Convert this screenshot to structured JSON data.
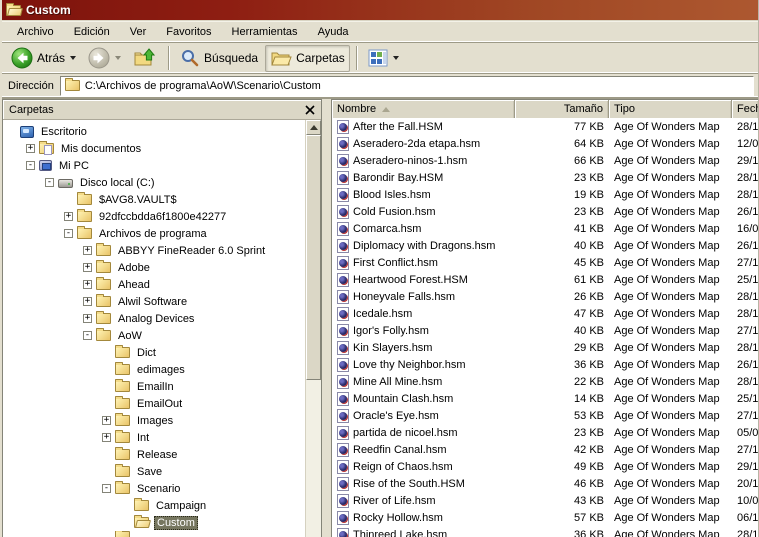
{
  "window": {
    "title": "Custom"
  },
  "menu": {
    "items": [
      {
        "label": "Archivo"
      },
      {
        "label": "Edición"
      },
      {
        "label": "Ver"
      },
      {
        "label": "Favoritos"
      },
      {
        "label": "Herramientas"
      },
      {
        "label": "Ayuda"
      }
    ]
  },
  "toolbar": {
    "back_label": "Atrás",
    "search_label": "Búsqueda",
    "folders_label": "Carpetas"
  },
  "address": {
    "label": "Dirección",
    "path": "C:\\Archivos de programa\\AoW\\Scenario\\Custom"
  },
  "folders_panel": {
    "title": "Carpetas"
  },
  "tree": {
    "items": [
      {
        "label": "Escritorio",
        "level": 0,
        "toggle": "",
        "icon": "desktop"
      },
      {
        "label": "Mis documentos",
        "level": 1,
        "toggle": "+",
        "icon": "folder-docs"
      },
      {
        "label": "Mi PC",
        "level": 1,
        "toggle": "-",
        "icon": "computer"
      },
      {
        "label": "Disco local (C:)",
        "level": 2,
        "toggle": "-",
        "icon": "drive"
      },
      {
        "label": "$AVG8.VAULT$",
        "level": 3,
        "toggle": "",
        "icon": "folder"
      },
      {
        "label": "92dfccbdda6f1800e42277",
        "level": 3,
        "toggle": "+",
        "icon": "folder"
      },
      {
        "label": "Archivos de programa",
        "level": 3,
        "toggle": "-",
        "icon": "folder"
      },
      {
        "label": "ABBYY FineReader 6.0 Sprint",
        "level": 4,
        "toggle": "+",
        "icon": "folder"
      },
      {
        "label": "Adobe",
        "level": 4,
        "toggle": "+",
        "icon": "folder"
      },
      {
        "label": "Ahead",
        "level": 4,
        "toggle": "+",
        "icon": "folder"
      },
      {
        "label": "Alwil Software",
        "level": 4,
        "toggle": "+",
        "icon": "folder"
      },
      {
        "label": "Analog Devices",
        "level": 4,
        "toggle": "+",
        "icon": "folder"
      },
      {
        "label": "AoW",
        "level": 4,
        "toggle": "-",
        "icon": "folder"
      },
      {
        "label": "Dict",
        "level": 5,
        "toggle": "",
        "icon": "folder"
      },
      {
        "label": "edimages",
        "level": 5,
        "toggle": "",
        "icon": "folder"
      },
      {
        "label": "EmailIn",
        "level": 5,
        "toggle": "",
        "icon": "folder"
      },
      {
        "label": "EmailOut",
        "level": 5,
        "toggle": "",
        "icon": "folder"
      },
      {
        "label": "Images",
        "level": 5,
        "toggle": "+",
        "icon": "folder"
      },
      {
        "label": "Int",
        "level": 5,
        "toggle": "+",
        "icon": "folder"
      },
      {
        "label": "Release",
        "level": 5,
        "toggle": "",
        "icon": "folder"
      },
      {
        "label": "Save",
        "level": 5,
        "toggle": "",
        "icon": "folder"
      },
      {
        "label": "Scenario",
        "level": 5,
        "toggle": "-",
        "icon": "folder"
      },
      {
        "label": "Campaign",
        "level": 6,
        "toggle": "",
        "icon": "folder"
      },
      {
        "label": "Custom",
        "level": 6,
        "toggle": "",
        "icon": "folder-open",
        "selected": true
      },
      {
        "label": "",
        "level": 5,
        "toggle": "",
        "icon": "folder",
        "partial": true
      }
    ]
  },
  "files": {
    "columns": {
      "name": "Nombre",
      "size": "Tamaño",
      "type": "Tipo",
      "date": "Fech"
    },
    "rows": [
      {
        "name": "After the Fall.HSM",
        "size": "77 KB",
        "type": "Age Of Wonders Map",
        "date": "28/1"
      },
      {
        "name": "Aseradero-2da etapa.hsm",
        "size": "64 KB",
        "type": "Age Of Wonders Map",
        "date": "12/0"
      },
      {
        "name": "Aseradero-ninos-1.hsm",
        "size": "66 KB",
        "type": "Age Of Wonders Map",
        "date": "29/1"
      },
      {
        "name": "Barondir Bay.HSM",
        "size": "23 KB",
        "type": "Age Of Wonders Map",
        "date": "28/1"
      },
      {
        "name": "Blood Isles.hsm",
        "size": "19 KB",
        "type": "Age Of Wonders Map",
        "date": "28/1"
      },
      {
        "name": "Cold Fusion.hsm",
        "size": "23 KB",
        "type": "Age Of Wonders Map",
        "date": "26/1"
      },
      {
        "name": "Comarca.hsm",
        "size": "41 KB",
        "type": "Age Of Wonders Map",
        "date": "16/0"
      },
      {
        "name": "Diplomacy with Dragons.hsm",
        "size": "40 KB",
        "type": "Age Of Wonders Map",
        "date": "26/1"
      },
      {
        "name": "First Conflict.hsm",
        "size": "45 KB",
        "type": "Age Of Wonders Map",
        "date": "27/1"
      },
      {
        "name": "Heartwood Forest.HSM",
        "size": "61 KB",
        "type": "Age Of Wonders Map",
        "date": "25/1"
      },
      {
        "name": "Honeyvale Falls.hsm",
        "size": "26 KB",
        "type": "Age Of Wonders Map",
        "date": "28/1"
      },
      {
        "name": "Icedale.hsm",
        "size": "47 KB",
        "type": "Age Of Wonders Map",
        "date": "28/1"
      },
      {
        "name": "Igor's Folly.hsm",
        "size": "40 KB",
        "type": "Age Of Wonders Map",
        "date": "27/1"
      },
      {
        "name": "Kin Slayers.hsm",
        "size": "29 KB",
        "type": "Age Of Wonders Map",
        "date": "28/1"
      },
      {
        "name": "Love thy Neighbor.hsm",
        "size": "36 KB",
        "type": "Age Of Wonders Map",
        "date": "26/1"
      },
      {
        "name": "Mine All Mine.hsm",
        "size": "22 KB",
        "type": "Age Of Wonders Map",
        "date": "28/1"
      },
      {
        "name": "Mountain Clash.hsm",
        "size": "14 KB",
        "type": "Age Of Wonders Map",
        "date": "25/1"
      },
      {
        "name": "Oracle's Eye.hsm",
        "size": "53 KB",
        "type": "Age Of Wonders Map",
        "date": "27/1"
      },
      {
        "name": "partida de nicoel.hsm",
        "size": "23 KB",
        "type": "Age Of Wonders Map",
        "date": "05/0"
      },
      {
        "name": "Reedfin Canal.hsm",
        "size": "42 KB",
        "type": "Age Of Wonders Map",
        "date": "27/1"
      },
      {
        "name": "Reign of Chaos.hsm",
        "size": "49 KB",
        "type": "Age Of Wonders Map",
        "date": "29/1"
      },
      {
        "name": "Rise of the South.HSM",
        "size": "46 KB",
        "type": "Age Of Wonders Map",
        "date": "20/1"
      },
      {
        "name": "River of Life.hsm",
        "size": "43 KB",
        "type": "Age Of Wonders Map",
        "date": "10/0"
      },
      {
        "name": "Rocky Hollow.hsm",
        "size": "57 KB",
        "type": "Age Of Wonders Map",
        "date": "06/1"
      },
      {
        "name": "Thinreed Lake.hsm",
        "size": "36 KB",
        "type": "Age Of Wonders Map",
        "date": "28/1"
      }
    ]
  }
}
